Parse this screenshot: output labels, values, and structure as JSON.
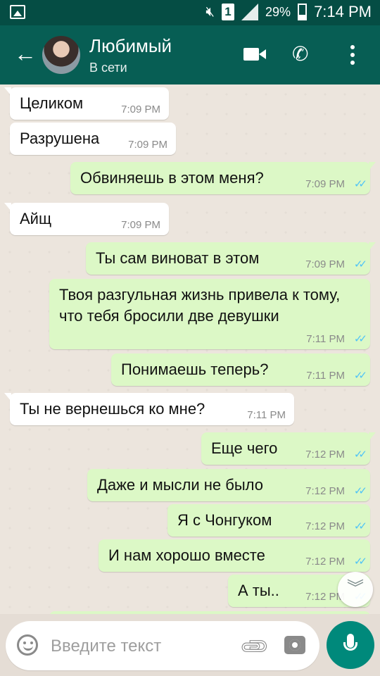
{
  "statusbar": {
    "battery_percent": "29%",
    "sim": "1",
    "time": "7:14 PM"
  },
  "header": {
    "contact_name": "Любимый",
    "status": "В сети",
    "icons": [
      "back-arrow-icon",
      "video-call-icon",
      "phone-icon",
      "more-vert-icon"
    ]
  },
  "messages": [
    {
      "dir": "in",
      "text": "Целиком",
      "time": "7:09 PM"
    },
    {
      "dir": "in",
      "text": "Разрушена",
      "time": "7:09 PM"
    },
    {
      "dir": "out",
      "text": "Обвиняешь в этом меня?",
      "time": "7:09 PM"
    },
    {
      "dir": "in",
      "text": "Айщ",
      "time": "7:09 PM"
    },
    {
      "dir": "out",
      "text": "Ты сам виноват в этом",
      "time": "7:09 PM"
    },
    {
      "dir": "out",
      "text": "Твоя разгульная жизнь привела к тому, что тебя бросили две девушки",
      "time": "7:11 PM"
    },
    {
      "dir": "out",
      "text": "Понимаешь теперь?",
      "time": "7:11 PM"
    },
    {
      "dir": "in",
      "text": "Ты не вернешься ко мне?",
      "time": "7:11 PM"
    },
    {
      "dir": "out",
      "text": "Еще чего",
      "time": "7:12 PM"
    },
    {
      "dir": "out",
      "text": "Даже и мысли не было",
      "time": "7:12 PM"
    },
    {
      "dir": "out",
      "text": "Я с Чонгуком",
      "time": "7:12 PM"
    },
    {
      "dir": "out",
      "text": "И нам хорошо вместе",
      "time": "7:12 PM"
    },
    {
      "dir": "out",
      "text": "А ты..",
      "time": "7:12 PM"
    }
  ],
  "composer": {
    "placeholder": "Введите текст"
  },
  "colors": {
    "header": "#075e54",
    "outgoing_bubble": "#dcf8c6",
    "incoming_bubble": "#ffffff",
    "read_ticks": "#4fc3f7",
    "mic_button": "#00897b"
  }
}
